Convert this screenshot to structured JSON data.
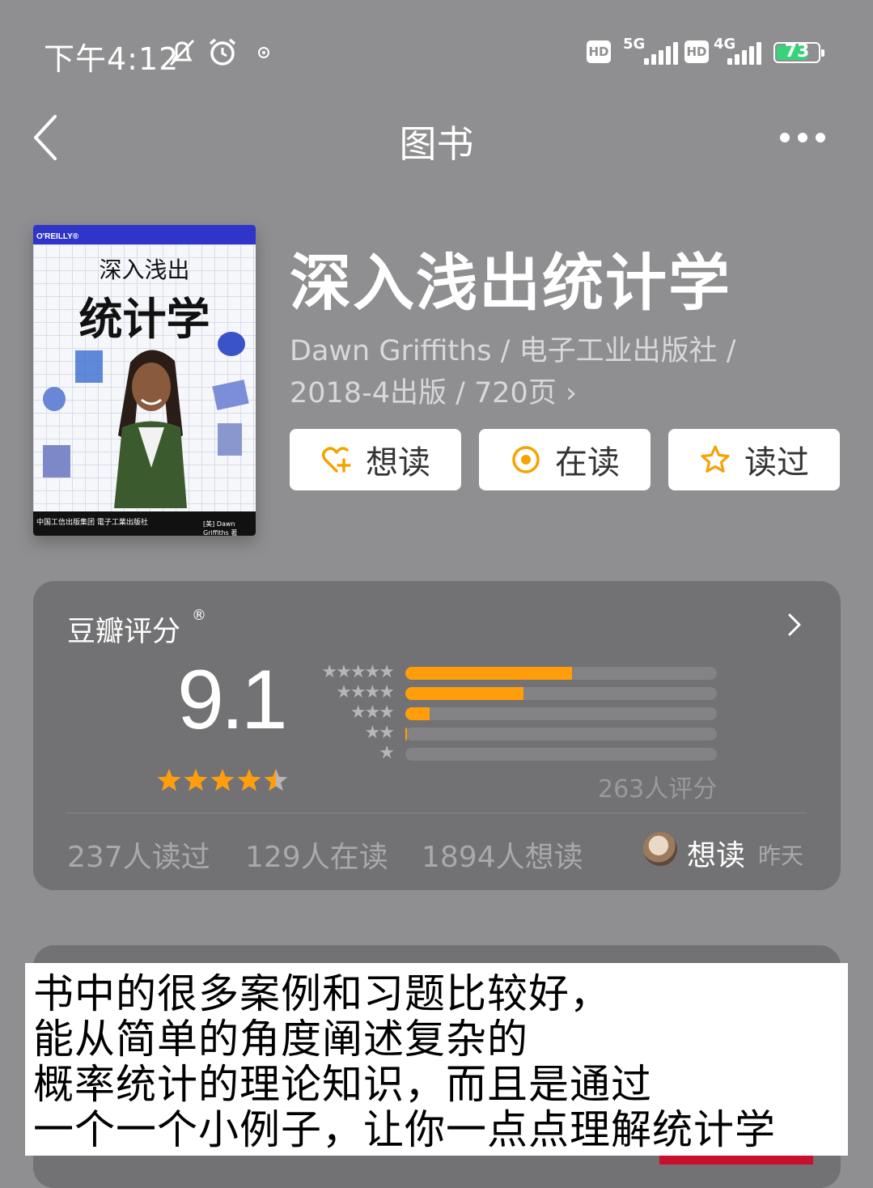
{
  "status_bar": {
    "time": "下午4:12",
    "network1": "5G",
    "network2": "4G",
    "hd_label": "HD",
    "battery": "73"
  },
  "nav": {
    "title": "图书"
  },
  "cover": {
    "brand": "O'REILLY®",
    "subtitle": "深入浅出",
    "main": "统计学",
    "publisher_strip": "中国工信出版集团  電子工業出版社",
    "author_strip": "[美] Dawn Griffiths 著"
  },
  "book": {
    "title": "深入浅出统计学",
    "meta_line1": "Dawn Griffiths / 电子工业出版社 /",
    "meta_line2": "2018-4出版 / 720页 ›"
  },
  "actions": {
    "want_read": "想读",
    "reading": "在读",
    "read": "读过"
  },
  "rating": {
    "title": "豆瓣评分",
    "registered": "®",
    "score": "9.1",
    "stars_value": 4.5,
    "count": "263人评分",
    "distribution": [
      {
        "stars": "★★★★★",
        "fraction": 0.535
      },
      {
        "stars": "★★★★",
        "fraction": 0.38
      },
      {
        "stars": "★★★",
        "fraction": 0.078
      },
      {
        "stars": "★★",
        "fraction": 0.006
      },
      {
        "stars": "★",
        "fraction": 0.0
      }
    ],
    "read_count": "237人读过",
    "reading_count": "129人在读",
    "want_count": "1894人想读",
    "friend_action": "想读",
    "friend_time": "昨天"
  },
  "caption": {
    "line1": "书中的很多案例和习题比较好，",
    "line2": "能从简单的角度阐述复杂的",
    "line3": "概率统计的理论知识，而且是通过",
    "line4": "一个一个小例子，让你一点点理解统计学"
  },
  "colors": {
    "background": "#8f8e90",
    "card": "#727173",
    "accent": "#ff9d0a",
    "battery": "#37d27a"
  }
}
